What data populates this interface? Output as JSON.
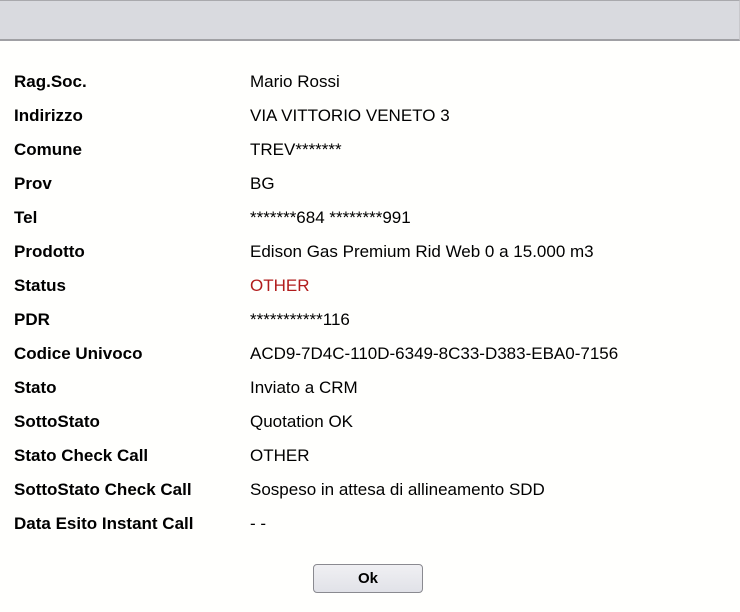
{
  "rows": [
    {
      "label": "Rag.Soc.",
      "value": "Mario Rossi"
    },
    {
      "label": "Indirizzo",
      "value": "VIA VITTORIO VENETO 3"
    },
    {
      "label": "Comune",
      "value": "TREV*******"
    },
    {
      "label": "Prov",
      "value": "BG"
    },
    {
      "label": "Tel",
      "value": "*******684  ********991"
    },
    {
      "label": "Prodotto",
      "value": "Edison Gas Premium Rid Web 0 a 15.000 m3"
    },
    {
      "label": "Status",
      "value": "OTHER"
    },
    {
      "label": "PDR",
      "value": "***********116"
    },
    {
      "label": "Codice Univoco",
      "value": "ACD9-7D4C-110D-6349-8C33-D383-EBA0-7156"
    },
    {
      "label": "Stato",
      "value": "Inviato a CRM"
    },
    {
      "label": "SottoStato",
      "value": "Quotation OK"
    },
    {
      "label": "Stato Check Call",
      "value": "OTHER"
    },
    {
      "label": "SottoStato Check Call",
      "value": "Sospeso in attesa di allineamento SDD"
    },
    {
      "label": "Data Esito Instant Call",
      "value": "- -"
    }
  ],
  "ok_label": "Ok",
  "colors": {
    "status": "#b11c1c"
  }
}
